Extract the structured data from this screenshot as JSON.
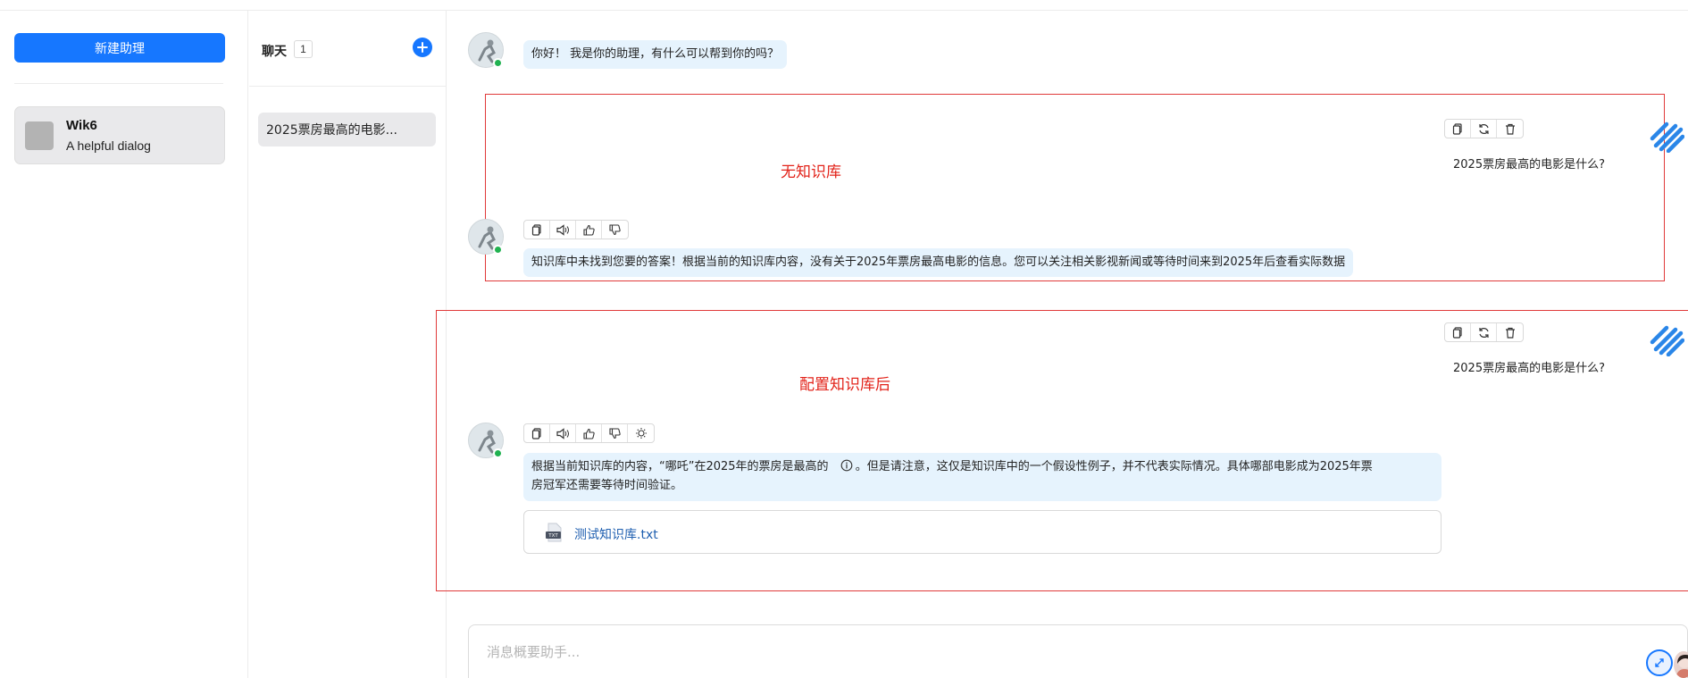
{
  "sidebar": {
    "new_button": "新建助理",
    "assistant": {
      "name": "Wik6",
      "description": "A helpful dialog"
    }
  },
  "chats": {
    "title": "聊天",
    "count": "1",
    "items": [
      {
        "label": "2025票房最高的电影..."
      }
    ]
  },
  "messages": {
    "greeting": "你好！ 我是你的助理，有什么可以帮到你的吗？",
    "user_question_1": "2025票房最高的电影是什么?",
    "answer_1": "知识库中未找到您要的答案！根据当前的知识库内容，没有关于2025年票房最高电影的信息。您可以关注相关影视新闻或等待时间来到2025年后查看实际数据",
    "user_question_2": "2025票房最高的电影是什么?",
    "answer_2_part1": "根据当前知识库的内容，“哪吒”在2025年的票房是最高的",
    "answer_2_part2": "。但是请注意，这仅是知识库中的一个假设性例子，并不代表实际情况。具体哪部电影成为2025年票",
    "answer_2_line2": "房冠军还需要等待时间验证。",
    "attachment": {
      "type_label": "TXT",
      "name": "测试知识库.txt"
    }
  },
  "annotations": {
    "box1_label": "无知识库",
    "box2_label": "配置知识库后"
  },
  "input": {
    "placeholder": "消息概要助手..."
  },
  "colors": {
    "accent": "#1677ff",
    "annotation_red": "#e2231a",
    "bubble_bg": "#e6f3fd",
    "online": "#21b251"
  }
}
